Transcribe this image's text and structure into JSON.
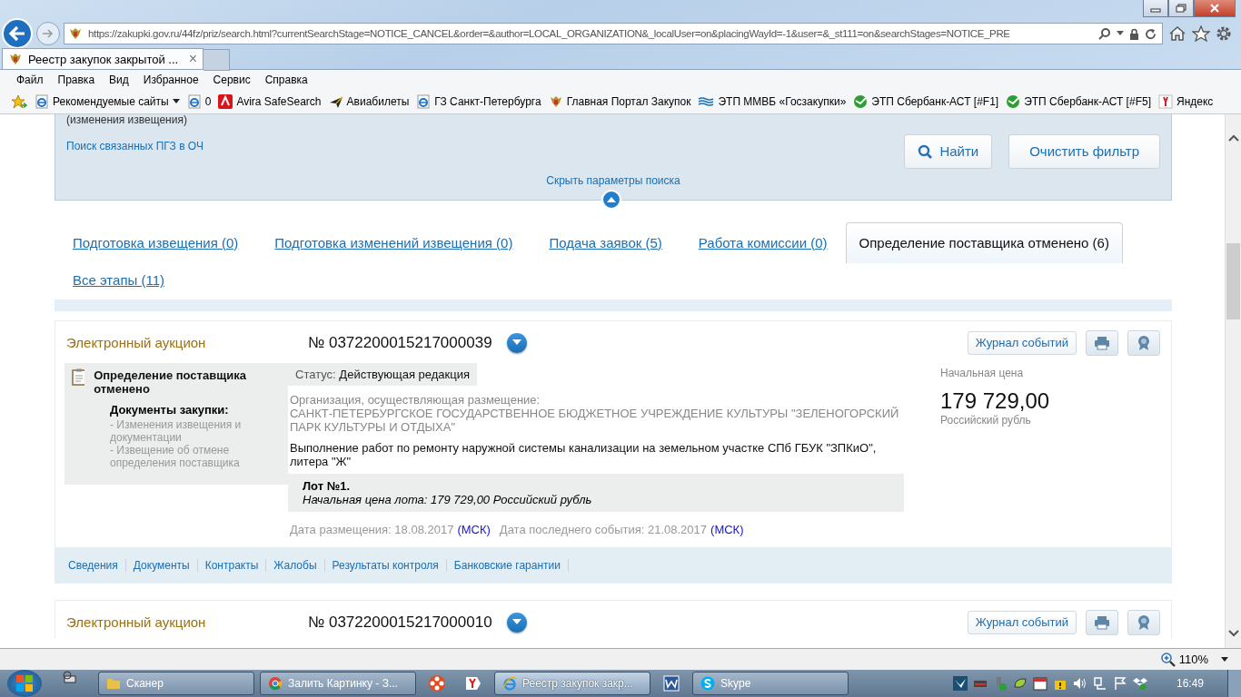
{
  "browser": {
    "address": "https://zakupki.gov.ru/44fz/priz/search.html?currentSearchStage=NOTICE_CANCEL&order=&author=LOCAL_ORGANIZATION&_localUser=on&placingWayId=-1&user=&_st111=on&searchStages=NOTICE_PRE",
    "tab_title": "Реестр закупок закрытой ...",
    "tab_close": "×",
    "menu": [
      "Файл",
      "Правка",
      "Вид",
      "Избранное",
      "Сервис",
      "Справка"
    ],
    "favorites": [
      {
        "label": "Рекомендуемые сайты",
        "kind": "ie",
        "dropdown": true
      },
      {
        "label": "0",
        "kind": "ie",
        "dropdown": false
      },
      {
        "label": "Avira SafeSearch",
        "kind": "avira",
        "dropdown": false
      },
      {
        "label": "Авиабилеты",
        "kind": "plane",
        "dropdown": false
      },
      {
        "label": "ГЗ Санкт-Петербурга",
        "kind": "ie",
        "dropdown": false
      },
      {
        "label": "Главная Портал Закупок",
        "kind": "emblem",
        "dropdown": false
      },
      {
        "label": "ЭТП ММВБ «Госзакупки»",
        "kind": "waves",
        "dropdown": false
      },
      {
        "label": "ЭТП Сбербанк-АСТ [#F1]",
        "kind": "sber",
        "dropdown": false
      },
      {
        "label": "ЭТП Сбербанк-АСТ [#F5]",
        "kind": "sber",
        "dropdown": false
      },
      {
        "label": "Яндекс",
        "kind": "yandex",
        "dropdown": false
      }
    ]
  },
  "search_panel": {
    "cut_label": "(изменения извещения)",
    "related_link": "Поиск связанных ПГЗ в ОЧ",
    "find_button": "Найти",
    "clear_button": "Очистить фильтр",
    "hide_link": "Скрыть параметры поиска"
  },
  "stage_tabs": [
    {
      "label": "Подготовка извещения (0)",
      "selected": false
    },
    {
      "label": "Подготовка изменений извещения (0)",
      "selected": false
    },
    {
      "label": "Подача заявок (5)",
      "selected": false
    },
    {
      "label": "Работа комиссии (0)",
      "selected": false
    },
    {
      "label": "Определение поставщика отменено (6)",
      "selected": true
    },
    {
      "label": "Все этапы (11)",
      "selected": false
    }
  ],
  "results": [
    {
      "type": "Электронный аукцион",
      "number": "№ 0372200015217000039",
      "journal_button": "Журнал событий",
      "stage": "Определение поставщика отменено",
      "docs_title": "Документы закупки:",
      "docs": [
        "- Изменения извещения и документации",
        "- Извещение об отмене определения поставщика"
      ],
      "status_label": "Статус:",
      "status_value": "Действующая редакция",
      "org_label": "Организация, осуществляющая размещение:",
      "org_name": "САНКТ-ПЕТЕРБУРГСКОЕ ГОСУДАРСТВЕННОЕ БЮДЖЕТНОЕ УЧРЕЖДЕНИЕ КУЛЬТУРЫ \"ЗЕЛЕНОГОРСКИЙ ПАРК КУЛЬТУРЫ И ОТДЫХА\"",
      "description": "Выполнение работ по ремонту наружной системы канализации на земельном участке СПб ГБУК \"ЗПКиО\", литера \"Ж\"",
      "lot_title": "Лот №1.",
      "lot_price": "Начальная цена лота: 179 729,00 Российский рубль",
      "posted": "Дата размещения: 18.08.2017",
      "posted_tz": "(МСК)",
      "last_event": "Дата последнего события: 21.08.2017",
      "last_tz": "(МСК)",
      "price_label": "Начальная цена",
      "price": "179 729,00",
      "currency": "Российский рубль",
      "links": [
        "Сведения",
        "Документы",
        "Контракты",
        "Жалобы",
        "Результаты контроля",
        "Банковские гарантии"
      ]
    },
    {
      "type": "Электронный аукцион",
      "number": "№ 0372200015217000010",
      "journal_button": "Журнал событий"
    }
  ],
  "status_bar": {
    "zoom": "110%"
  },
  "taskbar": {
    "items": [
      {
        "label": "Сканер",
        "kind": "folder",
        "selected": false
      },
      {
        "label": "Залить Картинку - З...",
        "kind": "chrome",
        "selected": false
      },
      {
        "kind": "circle",
        "selected": false
      },
      {
        "kind": "yandex",
        "selected": false
      },
      {
        "label": "Реестр закупок закр...",
        "kind": "ie",
        "selected": true
      },
      {
        "kind": "word",
        "selected": false
      },
      {
        "label": "Skype",
        "kind": "skype",
        "selected": false
      }
    ],
    "time": "16:49"
  }
}
